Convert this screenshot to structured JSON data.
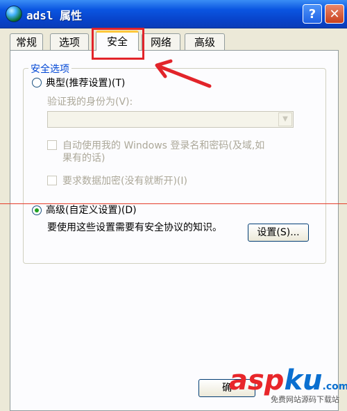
{
  "window": {
    "title": "adsl 属性",
    "help_label": "?",
    "close_label": "✕",
    "icon": "network-globe-icon"
  },
  "tabs": [
    {
      "label": "常规",
      "active": false
    },
    {
      "label": "选项",
      "active": false
    },
    {
      "label": "安全",
      "active": true
    },
    {
      "label": "网络",
      "active": false
    },
    {
      "label": "高级",
      "active": false
    }
  ],
  "security": {
    "group_label": "安全选项",
    "typical": {
      "label": "典型(推荐设置)(T)",
      "selected": false
    },
    "verify_label": "验证我的身份为(V):",
    "verify_value": "",
    "auto_logon": {
      "label_line1": "自动使用我的 Windows 登录名和密码(及域,如",
      "label_line2": "果有的话)",
      "checked": false
    },
    "require_encryption": {
      "label": "要求数据加密(没有就断开)(I)",
      "checked": false
    },
    "advanced": {
      "label": "高级(自定义设置)(D)",
      "selected": true
    },
    "advanced_desc": "要使用这些设置需要有安全协议的知识。",
    "settings_button": "设置(S)..."
  },
  "footer": {
    "ok_label": "确"
  },
  "watermark": {
    "brand_a": "asp",
    "brand_b": "ku",
    "suffix": ".com",
    "tagline": "免费网站源码下载站"
  },
  "colors": {
    "highlight": "#e2242a",
    "title_bar": "#0a55e1",
    "group_label": "#0046d5"
  }
}
